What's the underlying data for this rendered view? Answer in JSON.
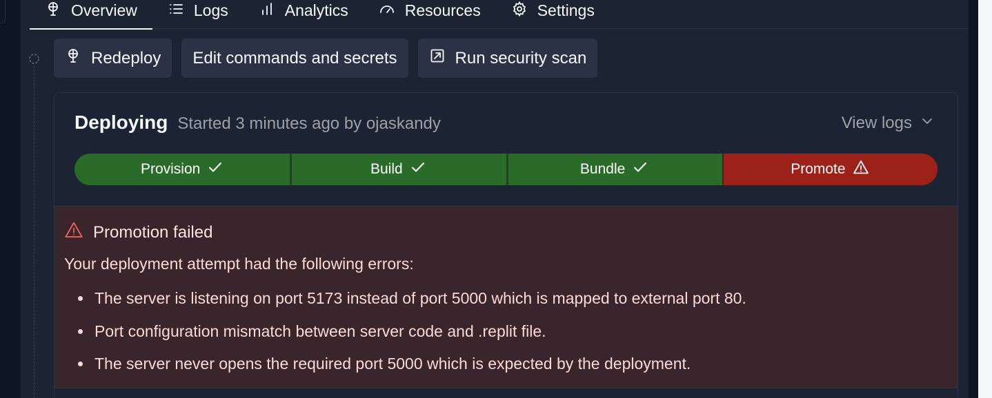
{
  "tabs": [
    {
      "label": "Overview",
      "icon": "deploy-icon",
      "active": true
    },
    {
      "label": "Logs",
      "icon": "list-icon",
      "active": false
    },
    {
      "label": "Analytics",
      "icon": "bar-chart-icon",
      "active": false
    },
    {
      "label": "Resources",
      "icon": "gauge-icon",
      "active": false
    },
    {
      "label": "Settings",
      "icon": "gear-icon",
      "active": false
    }
  ],
  "actions": {
    "redeploy": "Redeploy",
    "edit": "Edit commands and secrets",
    "scan": "Run security scan"
  },
  "deployment": {
    "status": "Deploying",
    "meta": "Started 3 minutes ago by ojaskandy",
    "view_logs": "View logs",
    "steps": [
      {
        "label": "Provision",
        "state": "success"
      },
      {
        "label": "Build",
        "state": "success"
      },
      {
        "label": "Bundle",
        "state": "success"
      },
      {
        "label": "Promote",
        "state": "failed"
      }
    ]
  },
  "error": {
    "title": "Promotion failed",
    "intro": "Your deployment attempt had the following errors:",
    "items": [
      "The server is listening on port 5173 instead of port 5000 which is mapped to external port 80.",
      "Port configuration mismatch between server code and .replit file.",
      "The server never opens the required port 5000 which is expected by the deployment."
    ]
  },
  "colors": {
    "success": "#2a6b2a",
    "failed": "#9b2119",
    "error_bg": "#3b252d",
    "panel_bg": "#1c2333"
  }
}
